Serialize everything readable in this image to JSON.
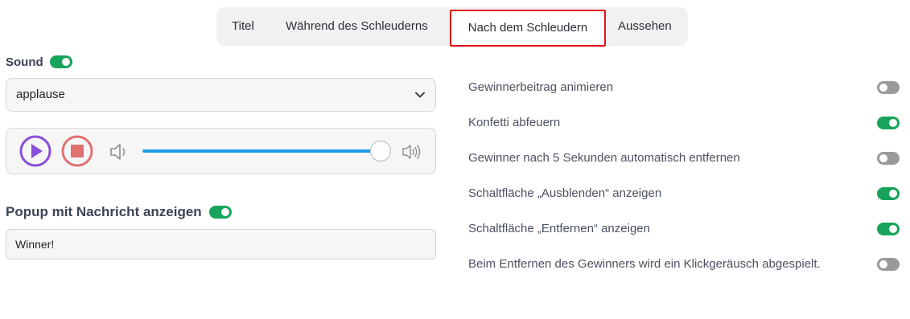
{
  "tabs": [
    {
      "label": "Titel"
    },
    {
      "label": "Während des Schleuderns"
    },
    {
      "label": "Nach dem Schleudern",
      "selected": true
    },
    {
      "label": "Aussehen"
    }
  ],
  "sound": {
    "label": "Sound",
    "enabled": true,
    "selected_value": "applause",
    "volume_fraction": 1.0
  },
  "popup": {
    "label": "Popup mit Nachricht anzeigen",
    "enabled": true,
    "message_value": "Winner!"
  },
  "options": [
    {
      "label": "Gewinnerbeitrag animieren",
      "enabled": false
    },
    {
      "label": "Konfetti abfeuern",
      "enabled": true
    },
    {
      "label": "Gewinner nach 5 Sekunden automatisch entfernen",
      "enabled": false
    },
    {
      "label": "Schaltfläche „Ausblenden“ anzeigen",
      "enabled": true
    },
    {
      "label": "Schaltfläche „Entfernen“ anzeigen",
      "enabled": true
    },
    {
      "label": "Beim Entfernen des Gewinners wird ein Klickgeräusch abgespielt.",
      "enabled": false
    }
  ],
  "colors": {
    "toggle_on": "#17a35b",
    "toggle_off": "#9a9a9a",
    "play": "#8a4fd6",
    "stop": "#e07070",
    "slider": "#1f9ce8",
    "selected_tab_border": "#e0101a"
  }
}
